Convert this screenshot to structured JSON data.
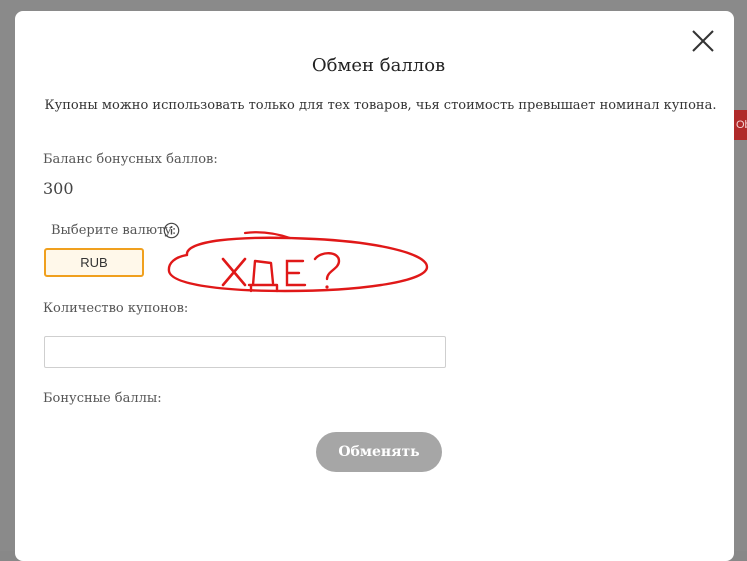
{
  "side_tab": {
    "label": "Ob"
  },
  "modal": {
    "title": "Обмен баллов",
    "notice": "Купоны можно использовать только для тех товаров, чья стоимость превышает номинал купона.",
    "balance": {
      "label": "Баланс бонусных баллов:",
      "value": "300"
    },
    "currency": {
      "label": "Выберите валюту:",
      "info_icon": "info-icon",
      "selected": "RUB"
    },
    "coupons": {
      "label": "Количество купонов:",
      "value": ""
    },
    "bonus": {
      "label": "Бонусные баллы:"
    },
    "exchange_button": "Обменять",
    "close_icon": "close-icon"
  },
  "annotation": {
    "text": "ХДЕ?",
    "color": "#e01818"
  },
  "colors": {
    "accent": "#f0a01e",
    "button_disabled": "#a6a6a6",
    "annotation_red": "#e01818"
  }
}
